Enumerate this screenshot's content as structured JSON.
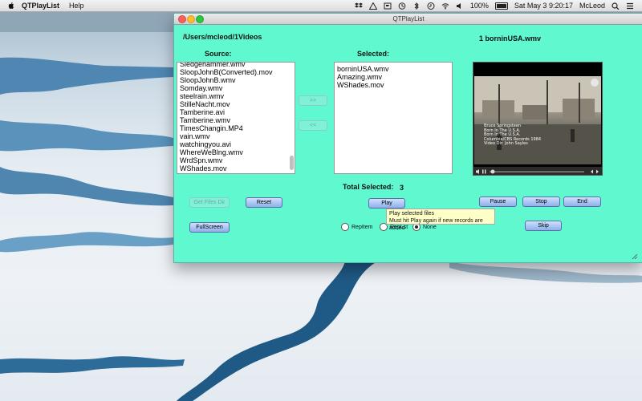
{
  "menubar": {
    "app_name": "QTPlayList",
    "menus": [
      "Help"
    ],
    "battery": "100%",
    "datetime": "Sat May 3  9:20:17",
    "user": "McLeod"
  },
  "window": {
    "title": "QTPlayList",
    "path": "/Users/mcleod/1Videos",
    "now_playing": "1 borninUSA.wmv",
    "source_label": "Source:",
    "selected_label": "Selected:",
    "source_items": [
      "Sledgehammer.wmv",
      "SloopJohnB(Converted).mov",
      "SloopJohnB.wmv",
      "Somday.wmv",
      "steelrain.wmv",
      "StilleNacht.mov",
      "Tamberine.avi",
      "Tamberine.wmv",
      "TimesChangin.MP4",
      "vain.wmv",
      "watchingyou.avi",
      "WhereWeBlng.wmv",
      "WrdSpn.wmv",
      "WShades.mov"
    ],
    "selected_items": [
      "borninUSA.wmv",
      "Amazing.wmv",
      "WShades.mov"
    ],
    "move_right": ">>",
    "move_left": "<<",
    "total_label": "Total Selected:",
    "total_value": "3",
    "buttons": {
      "get_files": "Get Files Dir",
      "reset": "Reset",
      "play": "Play",
      "pause": "Pause",
      "stop": "Stop",
      "end": "End",
      "fullscreen": "FullScreen",
      "skip": "Skip"
    },
    "radios": {
      "rep_item": "RepItem",
      "rep_list": "RepLst",
      "none": "None",
      "selected": "none"
    },
    "tooltip": {
      "line1": "Play selected files",
      "line2": "Must hit Play again if new records are added"
    },
    "video": {
      "caption_lines": [
        "Bruce Springsteen",
        "Born In The U.S.A.",
        "Born In The U.S.A.",
        "Columbia/CBS Records 1984",
        "Video Dir: John Sayles"
      ]
    }
  }
}
